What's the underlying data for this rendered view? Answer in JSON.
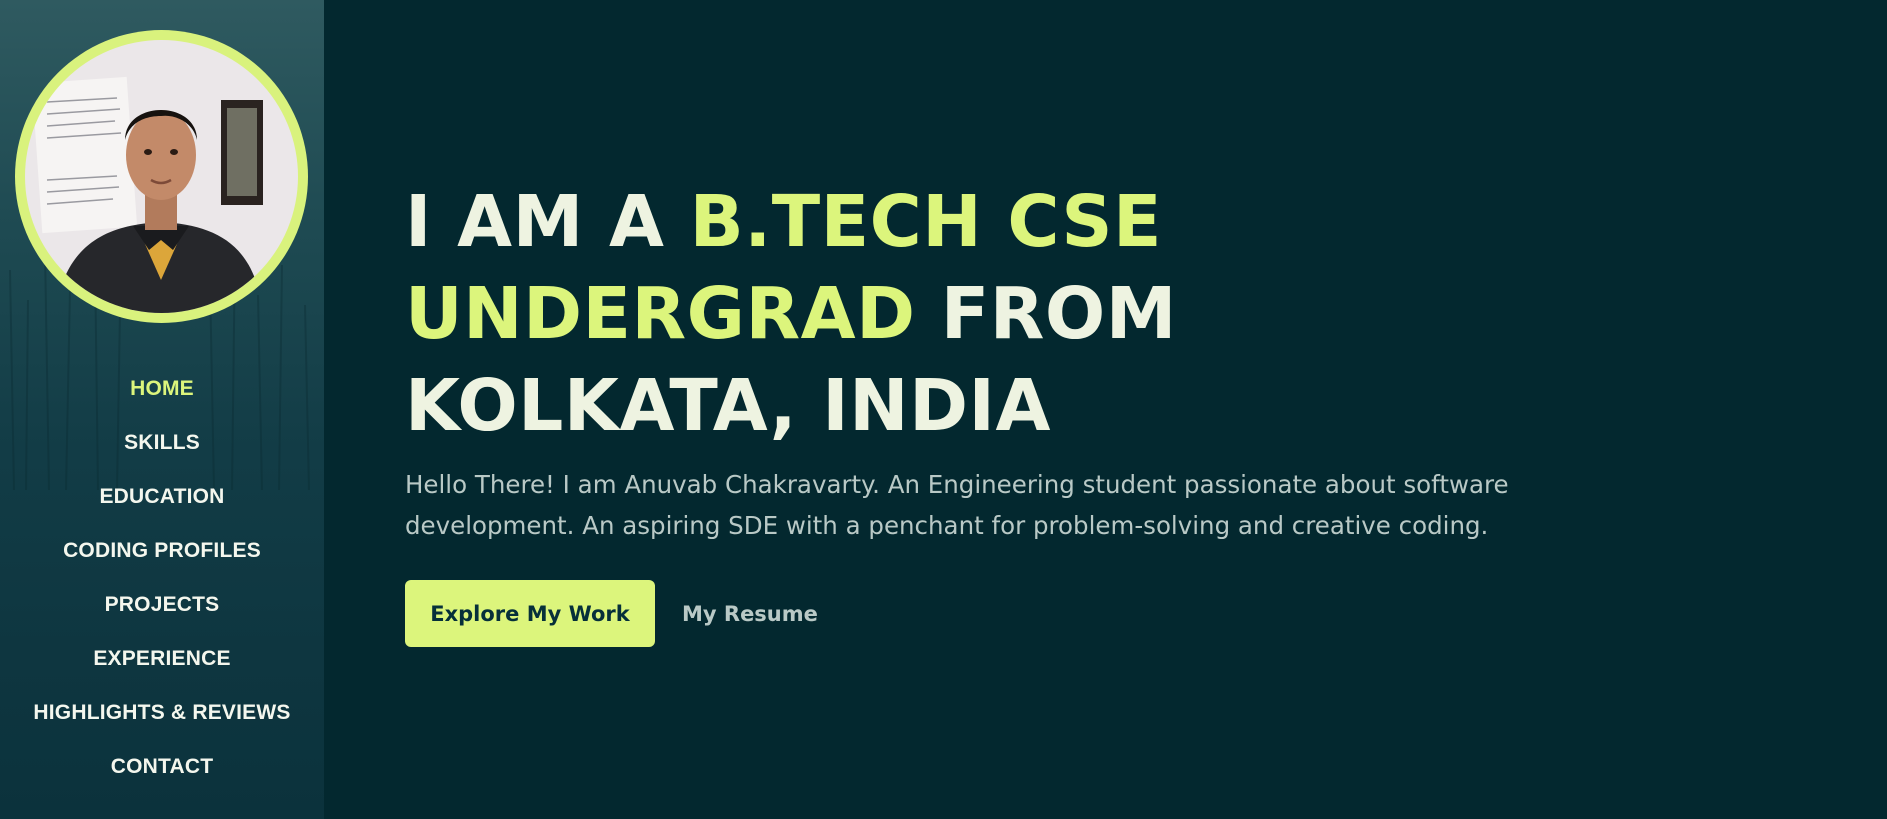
{
  "sidebar": {
    "avatar_alt": "Profile photo",
    "nav": [
      {
        "label": "HOME",
        "active": true
      },
      {
        "label": "SKILLS",
        "active": false
      },
      {
        "label": "EDUCATION",
        "active": false
      },
      {
        "label": "CODING PROFILES",
        "active": false
      },
      {
        "label": "PROJECTS",
        "active": false
      },
      {
        "label": "EXPERIENCE",
        "active": false
      },
      {
        "label": "HIGHLIGHTS & REVIEWS",
        "active": false
      },
      {
        "label": "CONTACT",
        "active": false
      }
    ]
  },
  "hero": {
    "headline_part1": "I AM A ",
    "headline_highlight": "B.TECH CSE UNDERGRAD",
    "headline_part2": " FROM KOLKATA, INDIA",
    "intro": "Hello There! I am Anuvab Chakravarty. An Engineering student passionate about software development. An aspiring SDE with a penchant for problem-solving and creative coding.",
    "primary_button": "Explore My Work",
    "secondary_link": "My Resume"
  },
  "colors": {
    "background": "#03282f",
    "accent": "#dcf57c",
    "sidebar": "#123c46",
    "heading": "#eef3e1",
    "body_text": "#b9c9c6"
  }
}
